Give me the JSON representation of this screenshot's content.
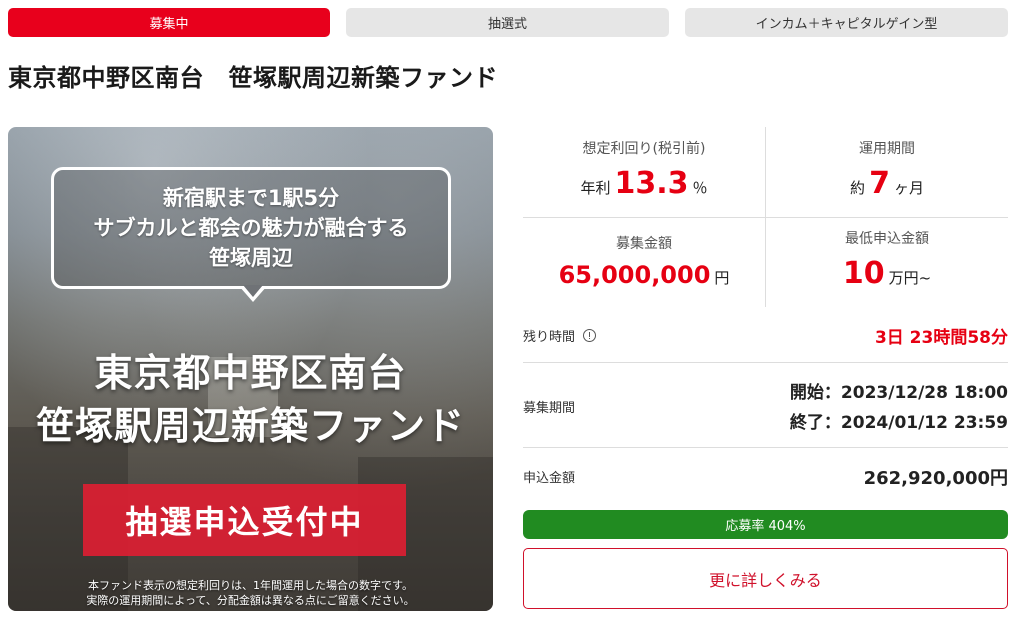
{
  "tags": {
    "status": "募集中",
    "method": "抽選式",
    "type": "インカム＋キャピタルゲイン型"
  },
  "title": "東京都中野区南台　笹塚駅周辺新築ファンド",
  "hero": {
    "bubble_lines": [
      "新宿駅まで1駅5分",
      "サブカルと都会の魅力が融合する",
      "笹塚周辺"
    ],
    "big_line1": "東京都中野区南台",
    "big_line2": "笹塚駅周辺新築ファンド",
    "badge": "抽選申込受付中",
    "note1": "本ファンド表示の想定利回りは、1年間運用した場合の数字です。",
    "note2": "実際の運用期間によって、分配金額は異なる点にご留意ください。"
  },
  "stats": {
    "yield": {
      "label": "想定利回り(税引前)",
      "prefix": "年利",
      "value": "13.3",
      "unit": "％"
    },
    "period": {
      "label": "運用期間",
      "prefix": "約",
      "value": "7",
      "unit": "ヶ月"
    },
    "amount": {
      "label": "募集金額",
      "value": "65,000,000",
      "unit": "円"
    },
    "min": {
      "label": "最低申込金額",
      "value": "10",
      "unit": "万円~"
    }
  },
  "rows": {
    "remaining_label": "残り時間",
    "remaining_value": "3日 23時間58分",
    "period_label": "募集期間",
    "start": "開始：2023/12/28 18:00",
    "end": "終了：2024/01/12 23:59",
    "applied_label": "申込金額",
    "applied_value": "262,920,000円"
  },
  "progress": {
    "text": "応募率 404%",
    "percent": 100,
    "color": "#218b21"
  },
  "more_button": "更に詳しくみる",
  "colors": {
    "accent": "#e60012",
    "tag_bg": "#e6e6e6"
  }
}
